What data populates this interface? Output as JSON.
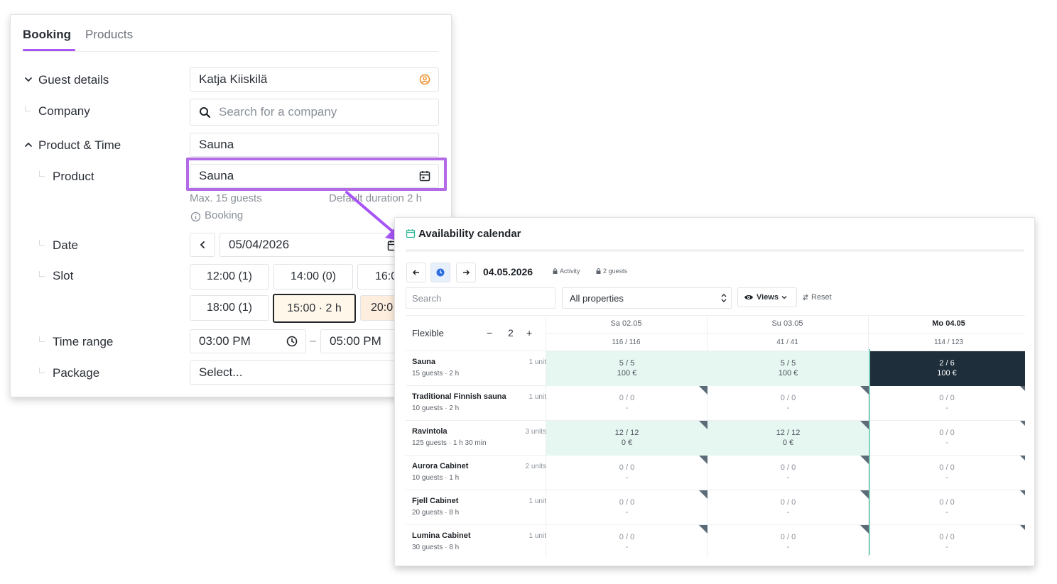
{
  "booking": {
    "tabs": [
      {
        "label": "Booking",
        "active": true
      },
      {
        "label": "Products",
        "active": false
      }
    ],
    "guest_details_label": "Guest details",
    "guest_name": "Katja Kiiskilä",
    "company_label": "Company",
    "company_placeholder": "Search for a company",
    "product_time_label": "Product & Time",
    "product_time_value": "Sauna",
    "product_label": "Product",
    "product_value": "Sauna",
    "product_max": "Max. 15 guests",
    "product_duration": "Default duration 2 h",
    "product_booking": "Booking",
    "date_label": "Date",
    "date_value": "05/04/2026",
    "slot_label": "Slot",
    "slots": [
      "12:00 (1)",
      "14:00 (0)",
      "16:0",
      "18:00 (1)",
      "15:00 · 2 h",
      "20:0"
    ],
    "selected_slot": "15:00 · 2 h",
    "time_range_label": "Time range",
    "time_from": "03:00 PM",
    "time_sep": "–",
    "time_to": "05:00 PM",
    "package_label": "Package",
    "package_placeholder": "Select...",
    "accent_color": "#a855f7",
    "highlight_color": "#b26ae6"
  },
  "calendar": {
    "title": "Availability calendar",
    "date": "04.05.2026",
    "chips": [
      "Activity",
      "2 guests"
    ],
    "search_placeholder": "Search",
    "properties_select": "All properties",
    "views_label": "Views",
    "reset_label": "Reset",
    "flexible_label": "Flexible",
    "stepper_minus": "−",
    "stepper_value": "2",
    "stepper_plus": "+",
    "days": [
      {
        "label": "Sa 02.05",
        "count": "116 / 116"
      },
      {
        "label": "Su 03.05",
        "count": "41 / 41"
      },
      {
        "label": "Mo 04.05",
        "count": "114 / 123"
      }
    ],
    "resources": [
      {
        "name": "Sauna",
        "sub": "15 guests · 2 h",
        "units": "1 unit",
        "cells": [
          {
            "top": "5 / 5",
            "bot": "100 €"
          },
          {
            "top": "5 / 5",
            "bot": "100 €"
          },
          {
            "top": "2 / 6",
            "bot": "100 €"
          }
        ]
      },
      {
        "name": "Traditional Finnish sauna",
        "sub": "10 guests · 2 h",
        "units": "1 unit",
        "cells": [
          {
            "top": "0 / 0",
            "bot": "-"
          },
          {
            "top": "0 / 0",
            "bot": "-"
          },
          {
            "top": "0 / 0",
            "bot": "-"
          }
        ]
      },
      {
        "name": "Ravintola",
        "sub": "125 guests · 1 h 30 min",
        "units": "3 units",
        "cells": [
          {
            "top": "12 / 12",
            "bot": "0 €"
          },
          {
            "top": "12 / 12",
            "bot": "0 €"
          },
          {
            "top": "0 / 0",
            "bot": "-"
          }
        ]
      },
      {
        "name": "Aurora Cabinet",
        "sub": "10 guests · 1 h",
        "units": "2 units",
        "cells": [
          {
            "top": "0 / 0",
            "bot": "-"
          },
          {
            "top": "0 / 0",
            "bot": "-"
          },
          {
            "top": "0 / 0",
            "bot": "-"
          }
        ]
      },
      {
        "name": "Fjell Cabinet",
        "sub": "20 guests · 8 h",
        "units": "1 unit",
        "cells": [
          {
            "top": "0 / 0",
            "bot": "-"
          },
          {
            "top": "0 / 0",
            "bot": "-"
          },
          {
            "top": "0 / 0",
            "bot": "-"
          }
        ]
      },
      {
        "name": "Lumina Cabinet",
        "sub": "30 guests · 8 h",
        "units": "1 unit",
        "cells": [
          {
            "top": "0 / 0",
            "bot": "-"
          },
          {
            "top": "0 / 0",
            "bot": "-"
          },
          {
            "top": "0 / 0",
            "bot": "-"
          }
        ]
      }
    ],
    "available_color": "#e6f6f1",
    "selected_color": "#1f2e3b",
    "today_line_color": "#7fd3bd"
  }
}
